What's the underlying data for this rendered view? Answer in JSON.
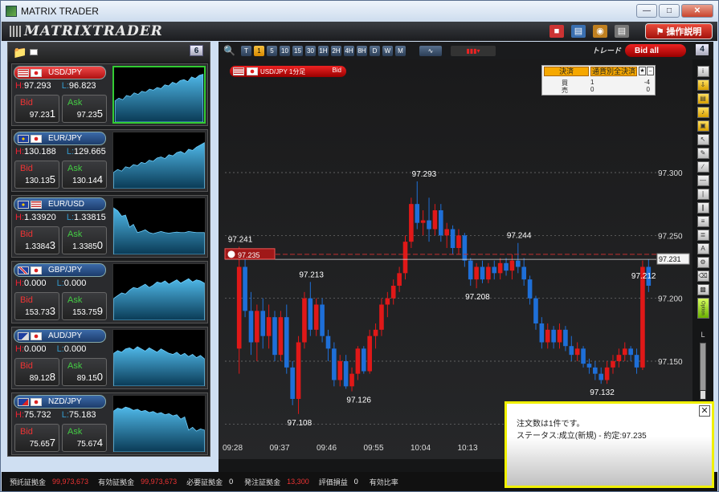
{
  "window": {
    "title": "MATRIX TRADER"
  },
  "toolbar": {
    "logo": "MATRIXTRADER",
    "help_label": "操作説明"
  },
  "left_panel": {
    "page": "6"
  },
  "labels": {
    "bid": "Bid",
    "ask": "Ask",
    "h": "H:",
    "l": "L:"
  },
  "pairs": [
    {
      "name": "USD/JPY",
      "flags": [
        "us",
        "jp"
      ],
      "high": "97.293",
      "low": "96.823",
      "bid_main": "97.23",
      "bid_last": "1",
      "ask_main": "97.23",
      "ask_last": "5",
      "active": true,
      "spark": [
        40,
        45,
        42,
        50,
        48,
        55,
        52,
        58,
        56,
        62,
        60,
        65,
        63,
        70,
        68,
        75,
        72,
        78,
        80,
        76,
        85,
        82,
        88,
        90
      ]
    },
    {
      "name": "EUR/JPY",
      "flags": [
        "eu",
        "jp"
      ],
      "high": "130.188",
      "low": "129.665",
      "bid_main": "130.13",
      "bid_last": "5",
      "ask_main": "130.14",
      "ask_last": "4",
      "active": false,
      "spark": [
        30,
        35,
        32,
        40,
        38,
        44,
        42,
        48,
        46,
        52,
        50,
        56,
        58,
        55,
        62,
        60,
        66,
        68,
        64,
        72,
        70,
        76,
        80,
        84
      ]
    },
    {
      "name": "EUR/USD",
      "flags": [
        "eu",
        "us"
      ],
      "high": "1.33920",
      "low": "1.33815",
      "bid_main": "1.3384",
      "bid_last": "3",
      "ask_main": "1.3385",
      "ask_last": "0",
      "active": false,
      "spark": [
        85,
        80,
        70,
        72,
        50,
        55,
        40,
        42,
        45,
        40,
        38,
        40,
        42,
        40,
        39,
        40,
        41,
        40,
        40,
        42,
        41,
        40,
        40,
        40
      ]
    },
    {
      "name": "GBP/JPY",
      "flags": [
        "gb",
        "jp"
      ],
      "high": "0.000",
      "low": "0.000",
      "bid_main": "153.73",
      "bid_last": "3",
      "ask_main": "153.75",
      "ask_last": "9",
      "active": false,
      "spark": [
        40,
        45,
        50,
        48,
        55,
        60,
        58,
        62,
        66,
        60,
        64,
        70,
        68,
        72,
        66,
        70,
        74,
        68,
        72,
        76,
        70,
        74,
        72,
        68
      ]
    },
    {
      "name": "AUD/JPY",
      "flags": [
        "au",
        "jp"
      ],
      "high": "0.000",
      "low": "0.000",
      "bid_main": "89.12",
      "bid_last": "8",
      "ask_main": "89.15",
      "ask_last": "0",
      "active": false,
      "spark": [
        60,
        65,
        62,
        68,
        70,
        66,
        72,
        68,
        64,
        70,
        66,
        62,
        68,
        64,
        60,
        58,
        62,
        56,
        60,
        54,
        58,
        52,
        56,
        50
      ]
    },
    {
      "name": "NZD/JPY",
      "flags": [
        "nz",
        "jp"
      ],
      "high": "75.732",
      "low": "75.183",
      "bid_main": "75.65",
      "bid_last": "7",
      "ask_main": "75.67",
      "ask_last": "4",
      "active": false,
      "spark": [
        75,
        80,
        78,
        82,
        80,
        76,
        78,
        74,
        76,
        72,
        74,
        70,
        72,
        68,
        70,
        66,
        68,
        60,
        64,
        40,
        45,
        38,
        42,
        40
      ]
    }
  ],
  "chart_toolbar": {
    "timeframes": [
      "T",
      "1",
      "5",
      "10",
      "15",
      "30",
      "1H",
      "2H",
      "4H",
      "8H",
      "D",
      "W",
      "M"
    ],
    "active_timeframe": "1",
    "trade_label": "トレード",
    "bid_all": "Bid all",
    "page": "4"
  },
  "chart_label": {
    "text": "USD/JPY 1分足",
    "side": "Bid"
  },
  "position_panel": {
    "tab1": "決済",
    "tab2": "通貨別全決済",
    "buy_label": "買",
    "sell_label": "売",
    "buy_qty": "1",
    "buy_pl": "-4",
    "sell_qty": "0",
    "sell_pl": "0"
  },
  "chart_data": {
    "type": "candlestick",
    "symbol": "USD/JPY",
    "timeframe": "1分足",
    "ylim": [
      97.09,
      97.39
    ],
    "yticks": [
      "97.300",
      "97.250",
      "97.200",
      "97.150",
      "97.100"
    ],
    "xticks": [
      "09:28",
      "09:37",
      "09:46",
      "09:55",
      "10:04",
      "10:13"
    ],
    "current_price": "97.231",
    "position_price": "97.235",
    "annotations": [
      {
        "label": "97.241",
        "idx": 0,
        "price": 97.241,
        "pos": "above"
      },
      {
        "label": "97.213",
        "idx": 12,
        "price": 97.213,
        "pos": "above"
      },
      {
        "label": "97.108",
        "idx": 10,
        "price": 97.108,
        "pos": "below"
      },
      {
        "label": "97.126",
        "idx": 20,
        "price": 97.126,
        "pos": "below"
      },
      {
        "label": "97.293",
        "idx": 31,
        "price": 97.293,
        "pos": "above"
      },
      {
        "label": "97.208",
        "idx": 40,
        "price": 97.208,
        "pos": "below"
      },
      {
        "label": "97.244",
        "idx": 47,
        "price": 97.244,
        "pos": "above"
      },
      {
        "label": "97.132",
        "idx": 61,
        "price": 97.132,
        "pos": "below"
      },
      {
        "label": "97.212",
        "idx": 68,
        "price": 97.212,
        "pos": "above"
      }
    ],
    "candles": [
      [
        97.16,
        97.241,
        97.14,
        97.225
      ],
      [
        97.225,
        97.232,
        97.185,
        97.19
      ],
      [
        97.19,
        97.205,
        97.155,
        97.165
      ],
      [
        97.165,
        97.195,
        97.15,
        97.19
      ],
      [
        97.19,
        97.2,
        97.16,
        97.17
      ],
      [
        97.17,
        97.195,
        97.16,
        97.185
      ],
      [
        97.185,
        97.19,
        97.15,
        97.155
      ],
      [
        97.155,
        97.19,
        97.15,
        97.185
      ],
      [
        97.185,
        97.195,
        97.14,
        97.145
      ],
      [
        97.145,
        97.15,
        97.115,
        97.12
      ],
      [
        97.12,
        97.17,
        97.108,
        97.165
      ],
      [
        97.165,
        97.205,
        97.16,
        97.2
      ],
      [
        97.2,
        97.213,
        97.17,
        97.175
      ],
      [
        97.175,
        97.2,
        97.17,
        97.195
      ],
      [
        97.195,
        97.2,
        97.165,
        97.17
      ],
      [
        97.17,
        97.175,
        97.15,
        97.16
      ],
      [
        97.16,
        97.165,
        97.13,
        97.135
      ],
      [
        97.135,
        97.155,
        97.13,
        97.15
      ],
      [
        97.15,
        97.155,
        97.128,
        97.13
      ],
      [
        97.13,
        97.145,
        97.126,
        97.14
      ],
      [
        97.14,
        97.162,
        97.135,
        97.16
      ],
      [
        97.16,
        97.162,
        97.14,
        97.142
      ],
      [
        97.142,
        97.175,
        97.14,
        97.17
      ],
      [
        97.17,
        97.18,
        97.16,
        97.175
      ],
      [
        97.175,
        97.2,
        97.17,
        97.195
      ],
      [
        97.195,
        97.205,
        97.185,
        97.2
      ],
      [
        97.2,
        97.215,
        97.195,
        97.21
      ],
      [
        97.21,
        97.225,
        97.205,
        97.22
      ],
      [
        97.22,
        97.25,
        97.215,
        97.245
      ],
      [
        97.245,
        97.28,
        97.24,
        97.275
      ],
      [
        97.275,
        97.293,
        97.255,
        97.26
      ],
      [
        97.26,
        97.27,
        97.25,
        97.262
      ],
      [
        97.262,
        97.28,
        97.245,
        97.255
      ],
      [
        97.255,
        97.275,
        97.25,
        97.27
      ],
      [
        97.27,
        97.275,
        97.245,
        97.25
      ],
      [
        97.25,
        97.26,
        97.24,
        97.255
      ],
      [
        97.255,
        97.258,
        97.235,
        97.24
      ],
      [
        97.24,
        97.255,
        97.235,
        97.25
      ],
      [
        97.25,
        97.252,
        97.225,
        97.23
      ],
      [
        97.23,
        97.232,
        97.21,
        97.215
      ],
      [
        97.215,
        97.228,
        97.208,
        97.225
      ],
      [
        97.225,
        97.23,
        97.212,
        97.215
      ],
      [
        97.215,
        97.228,
        97.212,
        97.225
      ],
      [
        97.225,
        97.23,
        97.215,
        97.22
      ],
      [
        97.22,
        97.232,
        97.215,
        97.228
      ],
      [
        97.228,
        97.232,
        97.218,
        97.222
      ],
      [
        97.222,
        97.235,
        97.215,
        97.23
      ],
      [
        97.23,
        97.244,
        97.22,
        97.225
      ],
      [
        97.225,
        97.232,
        97.21,
        97.215
      ],
      [
        97.215,
        97.218,
        97.195,
        97.2
      ],
      [
        97.2,
        97.202,
        97.175,
        97.18
      ],
      [
        97.18,
        97.185,
        97.16,
        97.165
      ],
      [
        97.165,
        97.18,
        97.16,
        97.175
      ],
      [
        97.175,
        97.178,
        97.16,
        97.165
      ],
      [
        97.165,
        97.18,
        97.16,
        97.175
      ],
      [
        97.175,
        97.178,
        97.158,
        97.162
      ],
      [
        97.162,
        97.17,
        97.15,
        97.155
      ],
      [
        97.155,
        97.165,
        97.15,
        97.16
      ],
      [
        97.16,
        97.162,
        97.145,
        97.148
      ],
      [
        97.148,
        97.152,
        97.14,
        97.145
      ],
      [
        97.145,
        97.15,
        97.135,
        97.14
      ],
      [
        97.14,
        97.145,
        97.132,
        97.135
      ],
      [
        97.135,
        97.15,
        97.132,
        97.145
      ],
      [
        97.145,
        97.155,
        97.14,
        97.15
      ],
      [
        97.15,
        97.16,
        97.145,
        97.155
      ],
      [
        97.155,
        97.165,
        97.15,
        97.16
      ],
      [
        97.16,
        97.162,
        97.15,
        97.155
      ],
      [
        97.155,
        97.16,
        97.14,
        97.145
      ],
      [
        97.145,
        97.23,
        97.143,
        97.225
      ],
      [
        97.225,
        97.231,
        97.205,
        97.21
      ]
    ]
  },
  "footer": [
    {
      "label": "預託証拠金",
      "value": "99,973,673",
      "red": true
    },
    {
      "label": "有効証拠金",
      "value": "99,973,673",
      "red": true
    },
    {
      "label": "必要証拠金",
      "value": "0",
      "red": false
    },
    {
      "label": "発注証拠金",
      "value": "13,300",
      "red": true
    },
    {
      "label": "評価損益",
      "value": "0",
      "red": false
    },
    {
      "label": "有効比率",
      "value": "",
      "red": false
    }
  ],
  "notify": {
    "line1": "注文数は1件です。",
    "line2": "ステータス:成立(新規) - 約定:97.235"
  },
  "colors": {
    "up": "#e01818",
    "down": "#1e6fd8"
  }
}
